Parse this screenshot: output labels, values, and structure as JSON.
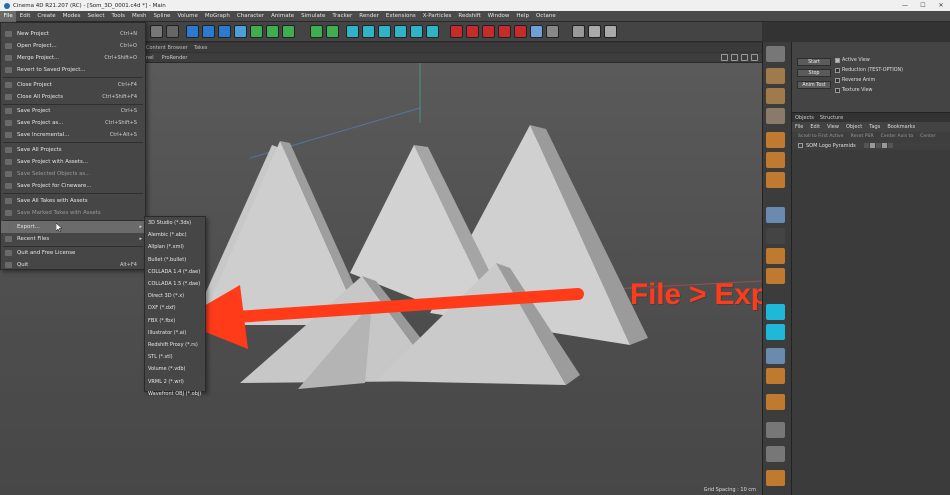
{
  "window": {
    "title": "Cinema 4D R21.207 (RC) - [Som_3D_0001.c4d *] - Main",
    "controls": [
      "—",
      "☐",
      "✕"
    ]
  },
  "menubar": [
    "File",
    "Edit",
    "Create",
    "Modes",
    "Select",
    "Tools",
    "Mesh",
    "Spline",
    "Volume",
    "MoGraph",
    "Character",
    "Animate",
    "Simulate",
    "Tracker",
    "Render",
    "Extensions",
    "X-Particles",
    "Redshift",
    "Window",
    "Help",
    "Octane"
  ],
  "tabs": {
    "content_browser": "Content Browser",
    "takes": "Takes"
  },
  "viewport": {
    "menu": [
      "nel",
      "ProRender"
    ],
    "grid_spacing": "Grid Spacing : 10 cm"
  },
  "file_menu": [
    {
      "label": "New Project",
      "shortcut": "Ctrl+N",
      "state": "normal"
    },
    {
      "label": "Open Project...",
      "shortcut": "Ctrl+O",
      "state": "normal"
    },
    {
      "label": "Merge Project...",
      "shortcut": "Ctrl+Shift+O",
      "state": "normal"
    },
    {
      "label": "Revert to Saved Project...",
      "shortcut": "",
      "state": "normal"
    },
    {
      "label": "Close Project",
      "shortcut": "Ctrl+F4",
      "state": "normal"
    },
    {
      "label": "Close All Projects",
      "shortcut": "Ctrl+Shift+F4",
      "state": "normal"
    },
    {
      "label": "Save Project",
      "shortcut": "Ctrl+S",
      "state": "normal"
    },
    {
      "label": "Save Project as...",
      "shortcut": "Ctrl+Shift+S",
      "state": "normal"
    },
    {
      "label": "Save Incremental...",
      "shortcut": "Ctrl+Alt+S",
      "state": "normal"
    },
    {
      "label": "Save All Projects",
      "shortcut": "",
      "state": "normal"
    },
    {
      "label": "Save Project with Assets...",
      "shortcut": "",
      "state": "normal"
    },
    {
      "label": "Save Selected Objects as...",
      "shortcut": "",
      "state": "dim"
    },
    {
      "label": "Save Project for Cineware...",
      "shortcut": "",
      "state": "normal"
    },
    {
      "label": "Save All Takes with Assets",
      "shortcut": "",
      "state": "normal"
    },
    {
      "label": "Save Marked Takes with Assets",
      "shortcut": "",
      "state": "dim"
    },
    {
      "label": "Export...",
      "shortcut": "",
      "state": "highlight",
      "submenu": true
    },
    {
      "label": "Recent Files",
      "shortcut": "",
      "state": "normal",
      "submenu": true
    },
    {
      "label": "Quit and Free License",
      "shortcut": "",
      "state": "normal"
    },
    {
      "label": "Quit",
      "shortcut": "Alt+F4",
      "state": "normal"
    }
  ],
  "export_submenu": [
    "3D Studio (*.3ds)",
    "Alembic (*.abc)",
    "Allplan (*.xml)",
    "Bullet (*.bullet)",
    "COLLADA 1.4 (*.dae)",
    "COLLADA 1.5 (*.dae)",
    "Direct 3D (*.x)",
    "DXF (*.dxf)",
    "FBX (*.fbx)",
    "Illustrator (*.ai)",
    "Redshift Proxy (*.rs)",
    "STL (*.stl)",
    "Volume (*.vdb)",
    "VRML 2 (*.wrl)",
    "Wavefront OBJ (*.obj)"
  ],
  "attributes": {
    "start": "Start",
    "stop": "Stop",
    "anim_test": "Anim Test",
    "active_view": "Active View",
    "reduction": "Reduction (TEST-OPTION)",
    "reverse_anim": "Reverse Anim",
    "texture_view": "Texture View"
  },
  "objects_panel": {
    "tabs": [
      "Objects",
      "Structure"
    ],
    "menu": [
      "File",
      "Edit",
      "View",
      "Object",
      "Tags",
      "Bookmarks"
    ],
    "sub": [
      "Scroll to First Active",
      "Reset PSR",
      "Center Axis to",
      "Center"
    ],
    "object_name": "SOM Logo Pyramids"
  },
  "annotation": "File > Export > FBX",
  "colors": {
    "arrow": "#ff3b1a",
    "highlight": "#6b6b6b"
  }
}
